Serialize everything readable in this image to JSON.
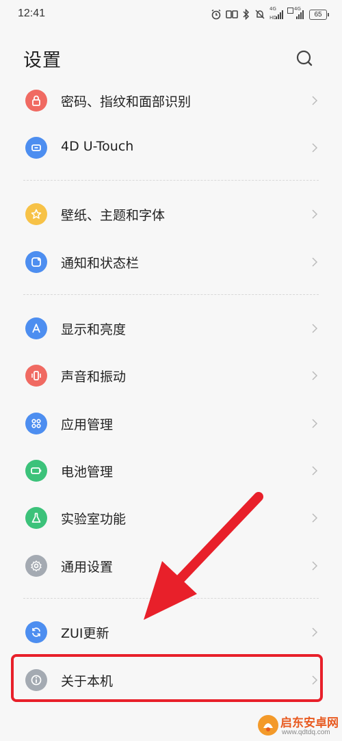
{
  "status_bar": {
    "time": "12:41",
    "signal1_label": "4G",
    "signal1_hd": "HD",
    "signal2_label": "4G",
    "battery": "65"
  },
  "header": {
    "title": "设置"
  },
  "items": [
    {
      "label": "密码、指纹和面部识别",
      "icon": "lock-icon",
      "color": "#f06a62"
    },
    {
      "label": "4D U-Touch",
      "icon": "touch-icon",
      "color": "#4d8ef0"
    },
    {
      "label": "壁纸、主题和字体",
      "icon": "star-icon",
      "color": "#f7c247"
    },
    {
      "label": "通知和状态栏",
      "icon": "notification-icon",
      "color": "#4d8ef0"
    },
    {
      "label": "显示和亮度",
      "icon": "display-icon",
      "color": "#4d8ef0"
    },
    {
      "label": "声音和振动",
      "icon": "vibration-icon",
      "color": "#f06a62"
    },
    {
      "label": "应用管理",
      "icon": "apps-icon",
      "color": "#4d8ef0"
    },
    {
      "label": "电池管理",
      "icon": "battery-icon",
      "color": "#3cc27a"
    },
    {
      "label": "实验室功能",
      "icon": "flask-icon",
      "color": "#3cc27a"
    },
    {
      "label": "通用设置",
      "icon": "gear-icon",
      "color": "#a4aab2"
    },
    {
      "label": "ZUI更新",
      "icon": "update-icon",
      "color": "#4d8ef0"
    },
    {
      "label": "关于本机",
      "icon": "info-icon",
      "color": "#a4aab2"
    }
  ],
  "annotation": {
    "highlight_color": "#e8202a"
  },
  "watermark": {
    "text": "启东安卓网",
    "url": "www.qdtdq.com"
  }
}
